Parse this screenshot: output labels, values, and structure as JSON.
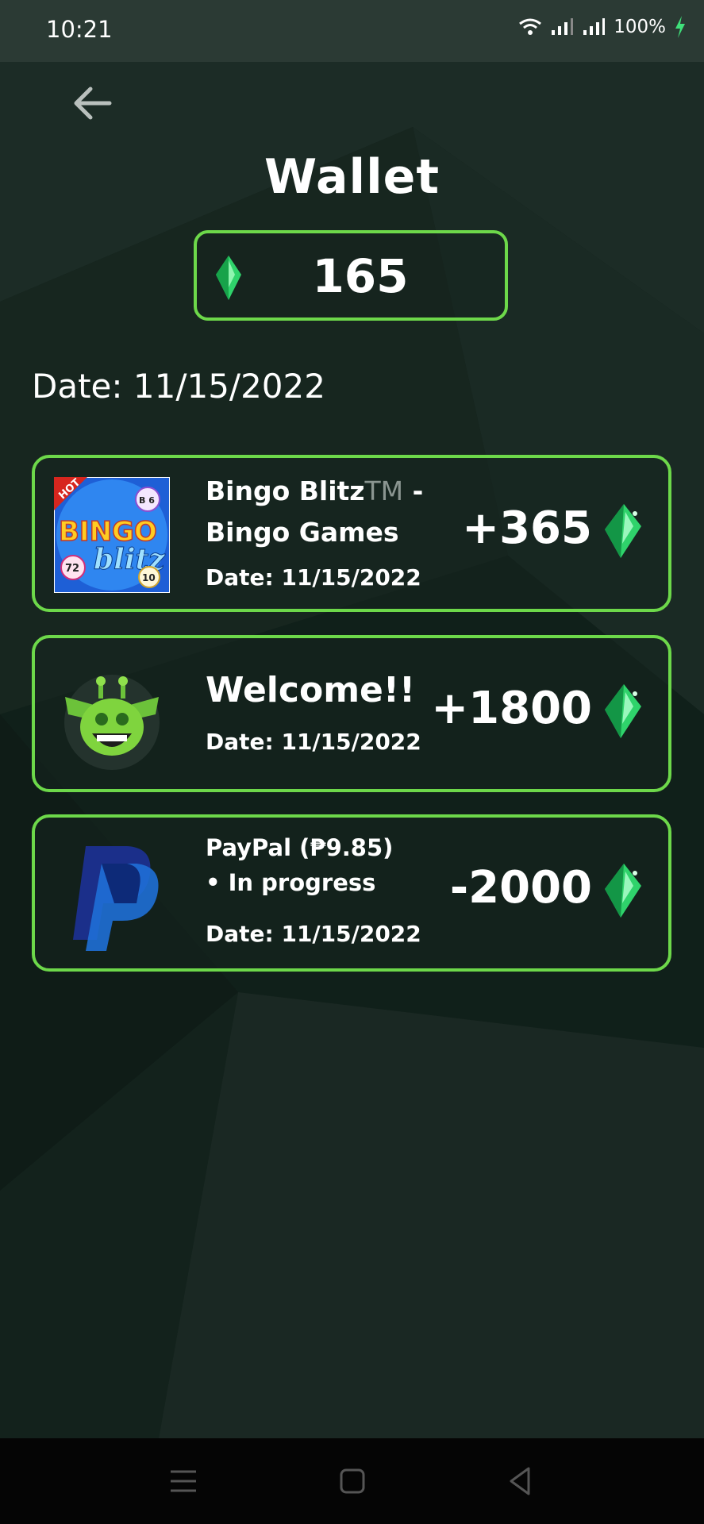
{
  "status_bar": {
    "time": "10:21",
    "battery": "100%"
  },
  "header": {
    "title": "Wallet"
  },
  "balance": {
    "value": "165"
  },
  "date_header": "Date: 11/15/2022",
  "transactions": [
    {
      "title_main": "Bingo Blitz",
      "title_tm": "TM",
      "title_suffix": " -",
      "title_line2": "Bingo Games",
      "date": "Date: 11/15/2022",
      "amount": "+365",
      "icon": "bingo-blitz-app-icon"
    },
    {
      "title_main": "Welcome!!",
      "date": "Date: 11/15/2022",
      "amount": "+1800",
      "icon": "giraffe-mascot-icon"
    },
    {
      "title_main": "PayPal (₱9.85)",
      "title_line2": "• In progress",
      "date": "Date: 11/15/2022",
      "amount": "-2000",
      "icon": "paypal-icon"
    }
  ],
  "bingo_icon_text": {
    "hot": "HOT",
    "bingo": "BINGO",
    "blitz": "blitz",
    "ball1": "B 6",
    "ball2": "72",
    "ball3": "10"
  },
  "colors": {
    "accent": "#6dd84a",
    "gem": "#2fd36b",
    "background": "#14211c",
    "status_bar": "#2b3a34",
    "nav_bar": "#050505"
  }
}
